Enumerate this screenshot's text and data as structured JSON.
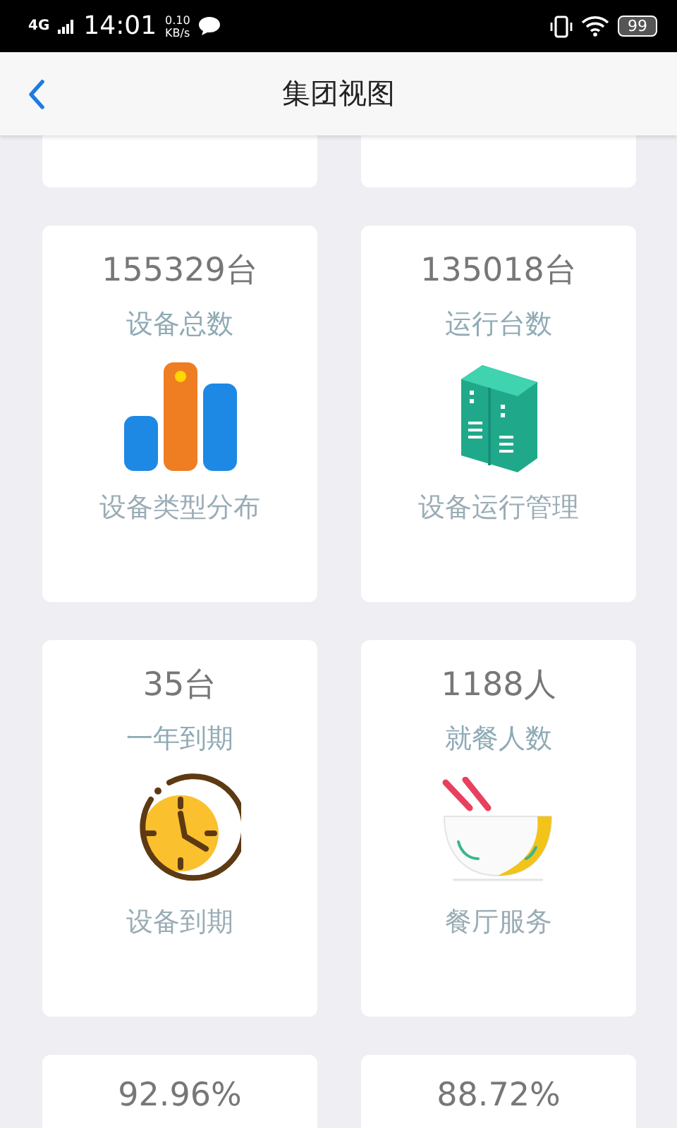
{
  "status_bar": {
    "network": "4G",
    "time": "14:01",
    "speed_value": "0.10",
    "speed_unit": "KB/s",
    "battery": "99"
  },
  "header": {
    "title": "集团视图"
  },
  "cards": [
    {
      "kind": "blank"
    },
    {
      "kind": "blank"
    },
    {
      "kind": "chart",
      "value": "155329台",
      "label": "设备总数",
      "action": "设备类型分布"
    },
    {
      "kind": "server",
      "value": "135018台",
      "label": "运行台数",
      "action": "设备运行管理"
    },
    {
      "kind": "clock",
      "value": "35台",
      "label": "一年到期",
      "action": "设备到期"
    },
    {
      "kind": "bowl",
      "value": "1188人",
      "label": "就餐人数",
      "action": "餐厅服务"
    },
    {
      "kind": "partial",
      "value": "92.96%"
    },
    {
      "kind": "partial",
      "value": "88.72%"
    }
  ]
}
